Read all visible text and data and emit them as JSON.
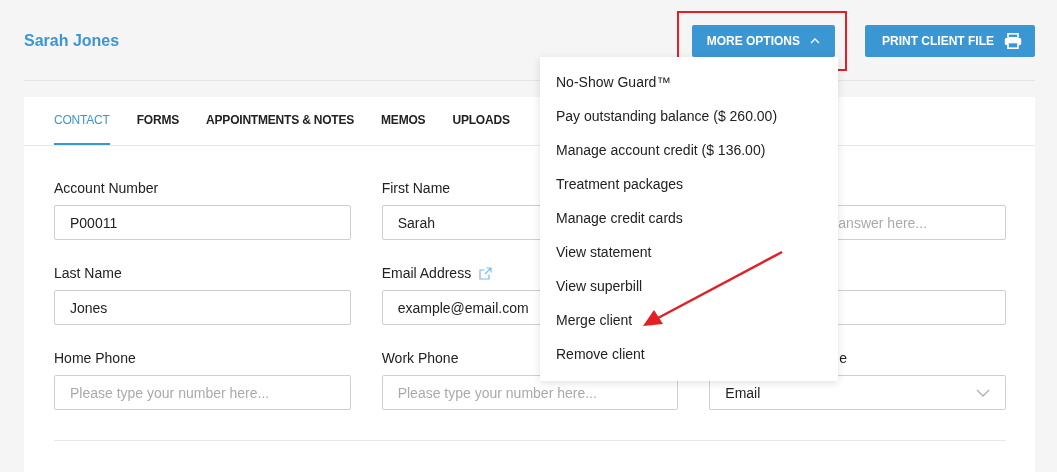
{
  "client_name": "Sarah Jones",
  "buttons": [
    {
      "label": "MORE OPTIONS",
      "kind": "menu"
    },
    {
      "label": "PRINT CLIENT FILE",
      "kind": "print"
    }
  ],
  "tabs": [
    {
      "label": "CONTACT",
      "selected": true
    },
    {
      "label": "FORMS",
      "selected": false
    },
    {
      "label": "APPOINTMENTS & NOTES",
      "selected": false
    },
    {
      "label": "MEMOS",
      "selected": false
    },
    {
      "label": "UPLOADS",
      "selected": false
    }
  ],
  "fields": [
    {
      "label": "Account Number",
      "value": "P00011",
      "kind": "text"
    },
    {
      "label": "First Name",
      "value": "Sarah",
      "kind": "text"
    },
    {
      "placeholder": "answer here...",
      "kind": "text"
    },
    {
      "label": "Last Name",
      "value": "Jones",
      "kind": "text"
    },
    {
      "label": "Email Address",
      "value": "example@email.com",
      "kind": "text",
      "link": true
    },
    {
      "kind": "text"
    },
    {
      "label": "Home Phone",
      "placeholder": "Please type your number here...",
      "kind": "text"
    },
    {
      "label": "Work Phone",
      "placeholder": "Please type your number here...",
      "kind": "text"
    },
    {
      "label": "e",
      "value": "Email",
      "kind": "select"
    }
  ],
  "menu": [
    "No-Show Guard™",
    "Pay outstanding balance ($ 260.00)",
    "Manage account credit ($ 136.00)",
    "Treatment packages",
    "Manage credit cards",
    "View statement",
    "View superbill",
    "Merge client",
    "Remove client"
  ]
}
